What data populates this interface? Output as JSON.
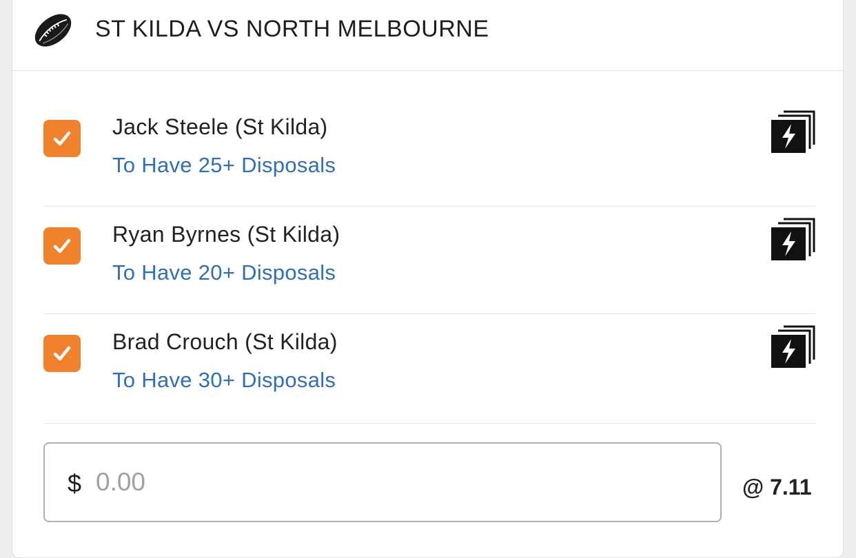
{
  "match": {
    "title": "ST KILDA VS NORTH MELBOURNE",
    "sport_icon": "football-icon"
  },
  "legs": [
    {
      "player": "Jack Steele (St Kilda)",
      "market": "To Have 25+ Disposals",
      "checked": true
    },
    {
      "player": "Ryan Byrnes (St Kilda)",
      "market": "To Have 20+ Disposals",
      "checked": true
    },
    {
      "player": "Brad Crouch (St Kilda)",
      "market": "To Have 30+ Disposals",
      "checked": true
    }
  ],
  "stake": {
    "currency": "$",
    "placeholder": "0.00",
    "value": ""
  },
  "odds": "@ 7.11",
  "colors": {
    "checkbox": "#f0822e",
    "market_link": "#2f6fb8",
    "text": "#222222"
  }
}
